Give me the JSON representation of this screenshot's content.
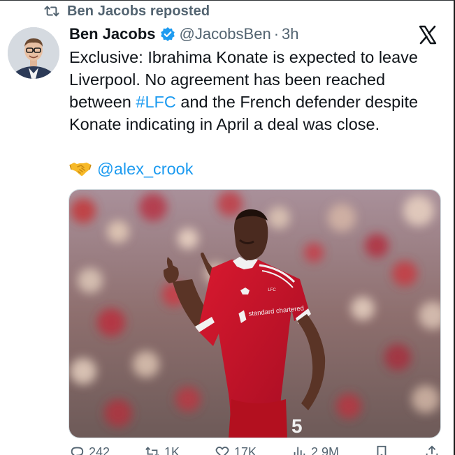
{
  "repost": {
    "label": "Ben Jacobs reposted",
    "icon": "repost-icon"
  },
  "author": {
    "display_name": "Ben Jacobs",
    "handle": "@JacobsBen",
    "separator": "·",
    "time": "3h",
    "verified_icon": "verified-badge-icon",
    "avatar_icon": "avatar"
  },
  "platform_logo": "x-logo-icon",
  "tweet": {
    "line1": "Exclusive: Ibrahima Konate is expected to leave",
    "line2": "Liverpool. No agreement has been reached",
    "line3_pre": "between ",
    "line3_hashtag": "#LFC",
    "line3_post": " and the French defender despite",
    "line4": "Konate indicating in April a deal was close."
  },
  "credit": {
    "icon": "handshake-icon",
    "mention": "@alex_crook"
  },
  "media": {
    "kit_sponsor": "standard chartered",
    "kit_number": "5",
    "kit_crest": "LFC"
  },
  "colors": {
    "text": "#0f1419",
    "secondary": "#536471",
    "accent": "#1d9bf0",
    "kit_red": "#c8102e"
  },
  "actions": [
    {
      "icon": "reply-icon",
      "count": "242"
    },
    {
      "icon": "repost-icon",
      "count": "1K"
    },
    {
      "icon": "like-icon",
      "count": "17K"
    },
    {
      "icon": "views-icon",
      "count": "2.9M"
    },
    {
      "icon": "bookmark-icon",
      "count": ""
    },
    {
      "icon": "share-icon",
      "count": ""
    }
  ]
}
